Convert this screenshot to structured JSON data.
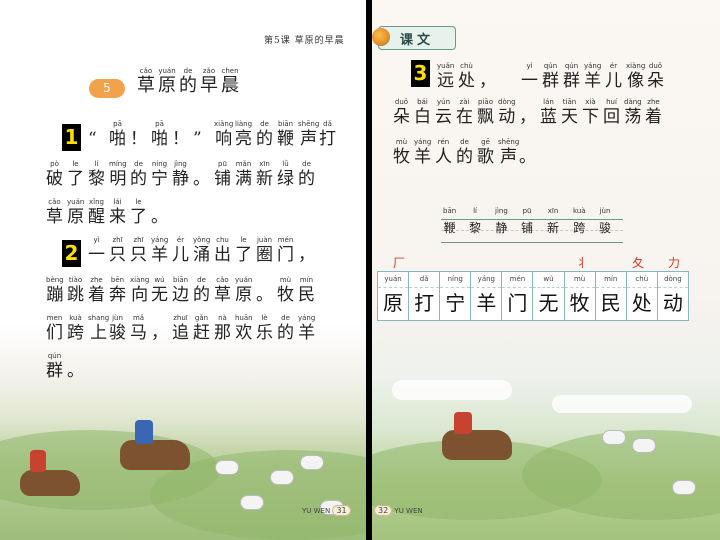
{
  "left_page": {
    "header": "第5课  草原的早晨",
    "lesson_number": "5",
    "title": [
      {
        "py": "cǎo",
        "hz": "草"
      },
      {
        "py": "yuán",
        "hz": "原"
      },
      {
        "py": "de",
        "hz": "的"
      },
      {
        "py": "zǎo",
        "hz": "早"
      },
      {
        "py": "chen",
        "hz": "晨"
      }
    ],
    "markers": [
      "1",
      "2"
    ],
    "lines": [
      [
        {
          "py": "",
          "hz": "“"
        },
        {
          "py": "pā",
          "hz": "啪"
        },
        {
          "py": "",
          "hz": "！"
        },
        {
          "py": "pā",
          "hz": "啪"
        },
        {
          "py": "",
          "hz": "！"
        },
        {
          "py": "",
          "hz": "”"
        },
        {
          "py": "xiǎng",
          "hz": "响"
        },
        {
          "py": "liàng",
          "hz": "亮"
        },
        {
          "py": "de",
          "hz": "的"
        },
        {
          "py": "biān",
          "hz": "鞭"
        },
        {
          "py": "shēng",
          "hz": "声"
        },
        {
          "py": "dǎ",
          "hz": "打"
        }
      ],
      [
        {
          "py": "pò",
          "hz": "破"
        },
        {
          "py": "le",
          "hz": "了"
        },
        {
          "py": "lí",
          "hz": "黎"
        },
        {
          "py": "míng",
          "hz": "明"
        },
        {
          "py": "de",
          "hz": "的"
        },
        {
          "py": "níng",
          "hz": "宁"
        },
        {
          "py": "jìng",
          "hz": "静"
        },
        {
          "py": "",
          "hz": "。"
        },
        {
          "py": "pū",
          "hz": "铺"
        },
        {
          "py": "mǎn",
          "hz": "满"
        },
        {
          "py": "xīn",
          "hz": "新"
        },
        {
          "py": "lǜ",
          "hz": "绿"
        },
        {
          "py": "de",
          "hz": "的"
        }
      ],
      [
        {
          "py": "cǎo",
          "hz": "草"
        },
        {
          "py": "yuán",
          "hz": "原"
        },
        {
          "py": "xǐng",
          "hz": "醒"
        },
        {
          "py": "lái",
          "hz": "来"
        },
        {
          "py": "le",
          "hz": "了"
        },
        {
          "py": "",
          "hz": "。"
        }
      ],
      [
        {
          "py": "yì",
          "hz": "一"
        },
        {
          "py": "zhī",
          "hz": "只"
        },
        {
          "py": "zhī",
          "hz": "只"
        },
        {
          "py": "yáng",
          "hz": "羊"
        },
        {
          "py": "ér",
          "hz": "儿"
        },
        {
          "py": "yǒng",
          "hz": "涌"
        },
        {
          "py": "chu",
          "hz": "出"
        },
        {
          "py": "le",
          "hz": "了"
        },
        {
          "py": "juàn",
          "hz": "圈"
        },
        {
          "py": "mén",
          "hz": "门"
        },
        {
          "py": "",
          "hz": "，"
        }
      ],
      [
        {
          "py": "bèng",
          "hz": "蹦"
        },
        {
          "py": "tiào",
          "hz": "跳"
        },
        {
          "py": "zhe",
          "hz": "着"
        },
        {
          "py": "bēn",
          "hz": "奔"
        },
        {
          "py": "xiàng",
          "hz": "向"
        },
        {
          "py": "wú",
          "hz": "无"
        },
        {
          "py": "biān",
          "hz": "边"
        },
        {
          "py": "de",
          "hz": "的"
        },
        {
          "py": "cǎo",
          "hz": "草"
        },
        {
          "py": "yuán",
          "hz": "原"
        },
        {
          "py": "",
          "hz": "。"
        },
        {
          "py": "mù",
          "hz": "牧"
        },
        {
          "py": "mín",
          "hz": "民"
        }
      ],
      [
        {
          "py": "men",
          "hz": "们"
        },
        {
          "py": "kuà",
          "hz": "跨"
        },
        {
          "py": "shang",
          "hz": "上"
        },
        {
          "py": "jùn",
          "hz": "骏"
        },
        {
          "py": "mǎ",
          "hz": "马"
        },
        {
          "py": "",
          "hz": "，"
        },
        {
          "py": "zhuī",
          "hz": "追"
        },
        {
          "py": "gǎn",
          "hz": "赶"
        },
        {
          "py": "nà",
          "hz": "那"
        },
        {
          "py": "huān",
          "hz": "欢"
        },
        {
          "py": "lè",
          "hz": "乐"
        },
        {
          "py": "de",
          "hz": "的"
        },
        {
          "py": "yáng",
          "hz": "羊"
        }
      ],
      [
        {
          "py": "qún",
          "hz": "群"
        },
        {
          "py": "",
          "hz": "。"
        }
      ]
    ],
    "footer_label": "YU WEN",
    "page_number": "31"
  },
  "right_page": {
    "tab_label": "课文",
    "marker": "3",
    "lines": [
      [
        {
          "py": "yuǎn",
          "hz": "远"
        },
        {
          "py": "chù",
          "hz": "处"
        },
        {
          "py": "",
          "hz": "，"
        },
        {
          "py": "",
          "hz": " "
        },
        {
          "py": "yì",
          "hz": "一"
        },
        {
          "py": "qún",
          "hz": "群"
        },
        {
          "py": "qún",
          "hz": "群"
        },
        {
          "py": "yáng",
          "hz": "羊"
        },
        {
          "py": "ér",
          "hz": "儿"
        },
        {
          "py": "xiàng",
          "hz": "像"
        },
        {
          "py": "duǒ",
          "hz": "朵"
        }
      ],
      [
        {
          "py": "duǒ",
          "hz": "朵"
        },
        {
          "py": "bái",
          "hz": "白"
        },
        {
          "py": "yún",
          "hz": "云"
        },
        {
          "py": "zài",
          "hz": "在"
        },
        {
          "py": "piāo",
          "hz": "飘"
        },
        {
          "py": "dòng",
          "hz": "动"
        },
        {
          "py": "",
          "hz": "，"
        },
        {
          "py": "lán",
          "hz": "蓝"
        },
        {
          "py": "tiān",
          "hz": "天"
        },
        {
          "py": "xià",
          "hz": "下"
        },
        {
          "py": "huí",
          "hz": "回"
        },
        {
          "py": "dàng",
          "hz": "荡"
        },
        {
          "py": "zhe",
          "hz": "着"
        }
      ],
      [
        {
          "py": "mù",
          "hz": "牧"
        },
        {
          "py": "yáng",
          "hz": "羊"
        },
        {
          "py": "rén",
          "hz": "人"
        },
        {
          "py": "de",
          "hz": "的"
        },
        {
          "py": "gē",
          "hz": "歌"
        },
        {
          "py": "shēng",
          "hz": "声"
        },
        {
          "py": "",
          "hz": "。"
        }
      ]
    ],
    "recognize_words": [
      {
        "py": "bān",
        "hz": "鞭"
      },
      {
        "py": "lí",
        "hz": "黎"
      },
      {
        "py": "jìng",
        "hz": "静"
      },
      {
        "py": "pū",
        "hz": "铺"
      },
      {
        "py": "xīn",
        "hz": "新"
      },
      {
        "py": "kuà",
        "hz": "跨"
      },
      {
        "py": "jùn",
        "hz": "骏"
      }
    ],
    "stroke_hints": [
      "厂",
      "丬",
      "夂",
      "力"
    ],
    "write_chars": [
      {
        "py": "yuán",
        "hz": "原"
      },
      {
        "py": "dǎ",
        "hz": "打"
      },
      {
        "py": "níng",
        "hz": "宁"
      },
      {
        "py": "yáng",
        "hz": "羊"
      },
      {
        "py": "mén",
        "hz": "门"
      },
      {
        "py": "wú",
        "hz": "无"
      },
      {
        "py": "mù",
        "hz": "牧"
      },
      {
        "py": "mín",
        "hz": "民"
      },
      {
        "py": "chù",
        "hz": "处"
      },
      {
        "py": "dòng",
        "hz": "动"
      }
    ],
    "footer_label": "YU WEN",
    "page_number": "32"
  }
}
